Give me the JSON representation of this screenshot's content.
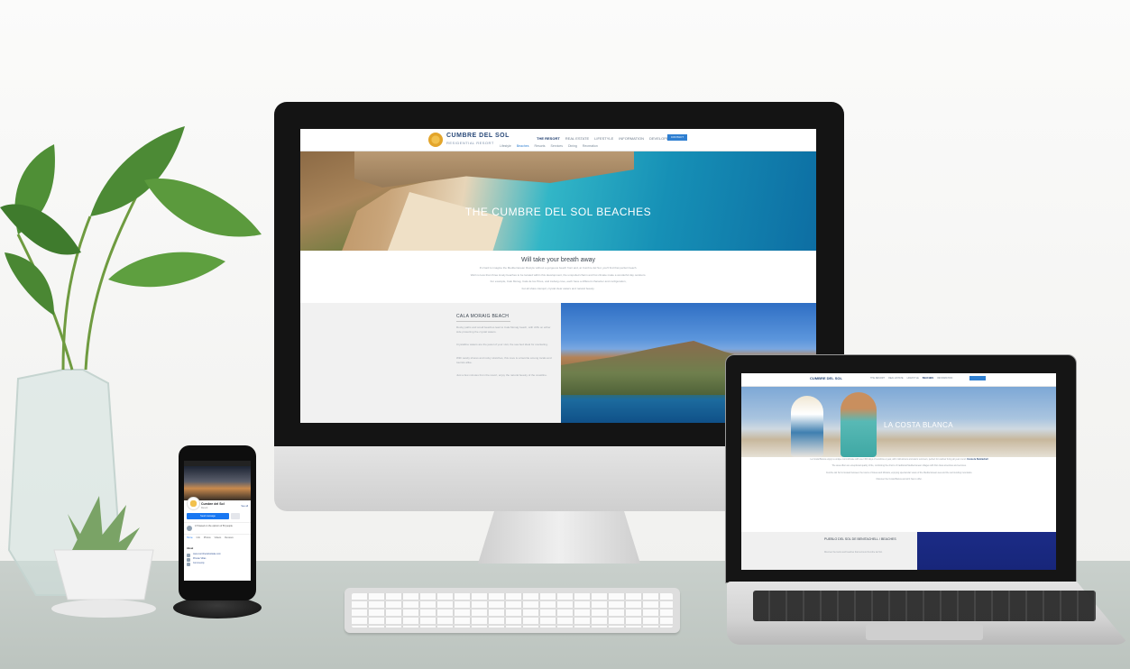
{
  "imac_site": {
    "brand": "CUMBRE DEL SOL",
    "brand_sub": "RESIDENTIAL RESORT",
    "nav": [
      "THE RESORT",
      "REAL ESTATE",
      "LIFESTYLE",
      "INFORMATION",
      "DEVELOPER"
    ],
    "contact": "CONTACT",
    "subnav": [
      "Lifestyle",
      "Beaches",
      "Resorts",
      "Services",
      "Dining",
      "Recreation"
    ],
    "hero_title": "THE CUMBRE DEL SOL BEACHES",
    "intro_heading": "Will take your breath away",
    "intro_lines": [
      "It's hard to imagine the Mediterranean lifestyle without a gorgeous beach front and, at Cumbre del Sol, you'll find that perfect beach.",
      "Well no less than three lovely beaches to be located within this development, the unspoiled charm and hot climate make a wonderful day outdoors.",
      "For example, Calo Morag, Cala de los Pinos, and Llebeig cove, each have a different character and configuration,",
      "but all share tranquil, crystal clear waters and natural beauty."
    ],
    "section_title": "CALA MORAIG BEACH",
    "section_paras": [
      "Rocky paths and small beaches lead to Cala Moraig beach, with cliffs on either side protecting the crystal waters.",
      "Crystalline waters are the jewel of your visit, the sea bed ideal for snorkeling.",
      "With sandy shores and rocky stretches, this cove is a favorite among locals and tourists alike.",
      "Just a few minutes from the resort, enjoy the natural beauty of the coastline."
    ]
  },
  "laptop_site": {
    "brand": "CUMBRE DEL SOL",
    "nav": [
      "THE RESORT",
      "REAL ESTATE",
      "LIFESTYLE",
      "BEACHES",
      "INFORMATION"
    ],
    "hero_title": "LA COSTA BLANCA",
    "intro_lead": "Costa de Benitachell",
    "intro_paras": [
      "La Costa Blanca enjoys a unique microclimate with over 300 days of sunshine a year, with mild winters and warm summers, perfect for outdoor living all year round.",
      "The area offers an exceptional quality of life, combining the charm of traditional Mediterranean villages with first class amenities and services.",
      "Cumbre del Sol is located between the towns of Jávea and Moraira, enjoying spectacular views of the Mediterranean sea and the surrounding mountains.",
      "Discover the Costa Blanca and all it has to offer."
    ],
    "section_title": "PUEBLO DEL SOL DE BENITACHELL / BEACHES",
    "section_para": "Discover the towns and beaches that surround Cumbre del Sol."
  },
  "phone_page": {
    "page_name": "Cumbre del Sol",
    "page_category": "Resort",
    "send_message": "Send message",
    "rating_text": "4.5 based on the opinion of 50 people",
    "tabs": [
      "Home",
      "Info",
      "Photos",
      "Videos",
      "Reviews"
    ],
    "about_heading": "About",
    "see_all": "See all",
    "links": [
      "www.cumbredelsolsale.com",
      "Private Villas",
      "Community"
    ]
  }
}
